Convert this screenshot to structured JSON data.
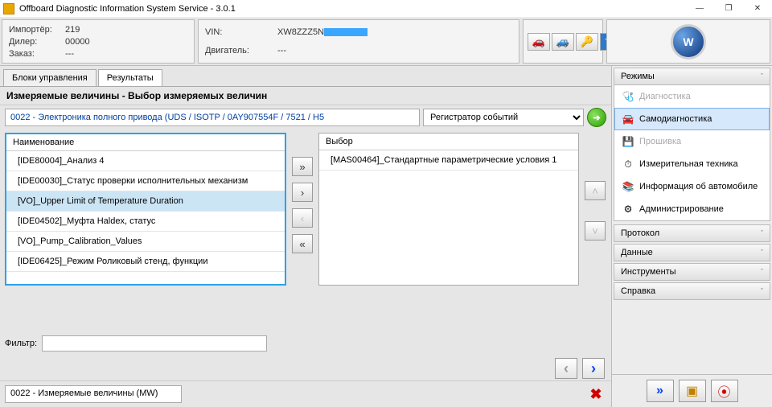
{
  "window": {
    "title": "Offboard Diagnostic Information System Service - 3.0.1",
    "minimize": "—",
    "maximize": "❐",
    "close": "✕"
  },
  "header": {
    "importer_label": "Импортёр:",
    "importer_val": "219",
    "dealer_label": "Дилер:",
    "dealer_val": "00000",
    "order_label": "Заказ:",
    "order_val": "---",
    "vin_label": "VIN:",
    "vin_val": "XW8ZZZ5N",
    "engine_label": "Двигатель:",
    "engine_val": "---",
    "toolbar_icons": {
      "car": "🚗",
      "nocar": "🚙",
      "key": "🔑",
      "usb": "🔌"
    }
  },
  "tabs": {
    "t1": "Блоки управления",
    "t2": "Результаты"
  },
  "subheader": "Измеряемые величины - Выбор измеряемых величин",
  "cu": {
    "desc": "0022 - Электроника полного привода  (UDS / ISOTP / 0AY907554F / 7521 / H5",
    "combo_value": "Регистратор событий"
  },
  "left": {
    "head": "Наименование",
    "items": [
      "[IDE80004]_Анализ 4",
      "[IDE00030]_Статус проверки исполнительных механизм",
      "[VO]_Upper Limit of Temperature Duration",
      "[IDE04502]_Муфта Haldex, статус",
      "[VO]_Pump_Calibration_Values",
      "[IDE06425]_Режим Роликовый стенд, функции"
    ],
    "selected_index": 2
  },
  "right": {
    "head": "Выбор",
    "items": [
      "[MAS00464]_Стандартные параметрические условия 1"
    ]
  },
  "move": {
    "all_right": "»",
    "right": "›",
    "left": "‹",
    "all_left": "«",
    "up": "˄",
    "down": "˅"
  },
  "filter": {
    "label": "Фильтр:",
    "value": ""
  },
  "nav": {
    "prev": "‹",
    "next": "›"
  },
  "status": {
    "text": "0022 - Измеряемые величины (MW)",
    "x": "✖"
  },
  "side": {
    "modes": {
      "head": "Режимы",
      "items": [
        {
          "icon": "🩺",
          "label": "Диагностика",
          "disabled": true
        },
        {
          "icon": "🚘",
          "label": "Самодиагностика",
          "selected": true
        },
        {
          "icon": "💾",
          "label": "Прошивка",
          "disabled": true
        },
        {
          "icon": "⏱",
          "label": "Измерительная техника"
        },
        {
          "icon": "📚",
          "label": "Информация об автомобиле"
        },
        {
          "icon": "⚙",
          "label": "Администрирование"
        }
      ]
    },
    "sections": [
      "Протокол",
      "Данные",
      "Инструменты",
      "Справка"
    ],
    "foot": {
      "b1": "»",
      "b2": "▣",
      "b3": "⦿"
    }
  }
}
